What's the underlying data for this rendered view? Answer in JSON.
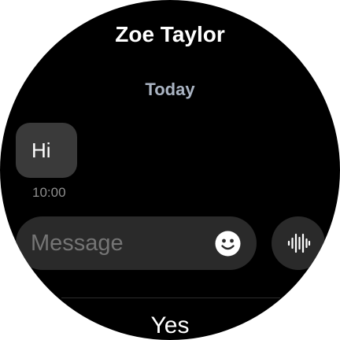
{
  "header": {
    "contact_name": "Zoe Taylor"
  },
  "conversation": {
    "date_separator": "Today",
    "messages": [
      {
        "text": "Hi",
        "time": "10:00"
      }
    ]
  },
  "composer": {
    "placeholder": "Message",
    "emoji_icon": "smiley-face-icon",
    "voice_icon": "voice-waveform-icon"
  },
  "quick_replies": {
    "items": [
      "Yes"
    ]
  },
  "colors": {
    "background": "#000000",
    "bubble": "#3a3a3a",
    "input": "#2a2a2a",
    "date_text": "#aab4c3",
    "secondary_text": "#8e8e8e"
  }
}
